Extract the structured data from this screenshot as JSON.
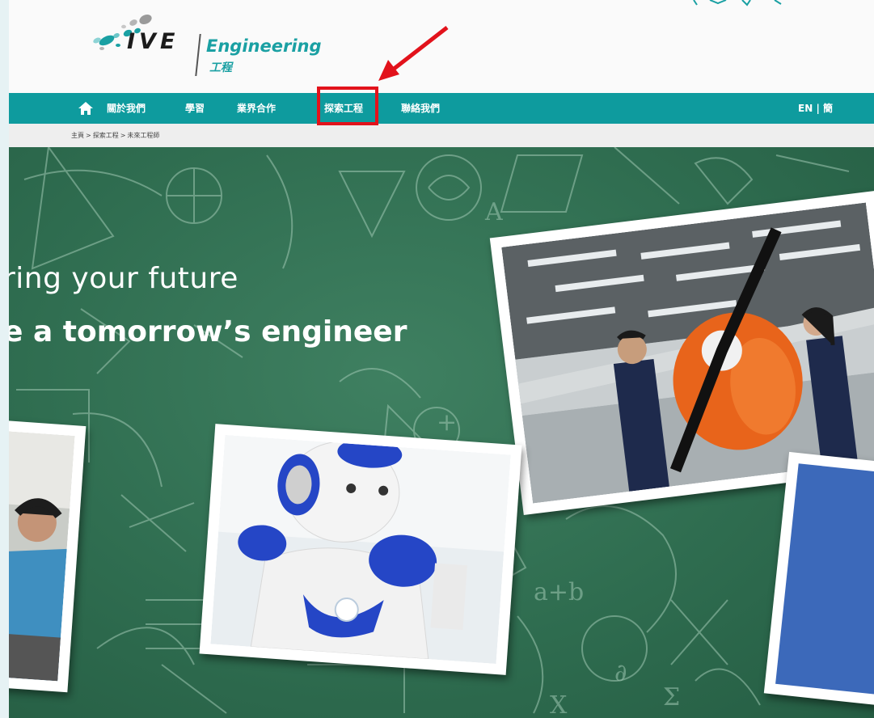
{
  "header": {
    "logo_text": "IVE",
    "logo_sub_en": "Engineering",
    "logo_sub_cn": "工程"
  },
  "nav": {
    "items": [
      {
        "label": "關於我們"
      },
      {
        "label": "學習"
      },
      {
        "label": "業界合作"
      },
      {
        "label": "探索工程"
      },
      {
        "label": "聯絡我們"
      }
    ],
    "lang_en": "EN",
    "lang_sep": "|",
    "lang_cn": "簡"
  },
  "breadcrumb": {
    "items": [
      "主頁",
      "探索工程",
      "未來工程師"
    ],
    "separator": ">"
  },
  "hero": {
    "line1": "ring your future",
    "line2": "e a tomorrow’s engineer"
  },
  "annotation": {
    "highlight_target": "探索工程",
    "color": "#e2121b"
  },
  "colors": {
    "nav_bg": "#0e9b9e",
    "brand_teal": "#1aa0a3",
    "chalkboard": "#2f6d50"
  },
  "icons": {
    "home": "home-icon",
    "arrow": "red-arrow-icon",
    "logo": "ive-logo-dots-icon"
  }
}
